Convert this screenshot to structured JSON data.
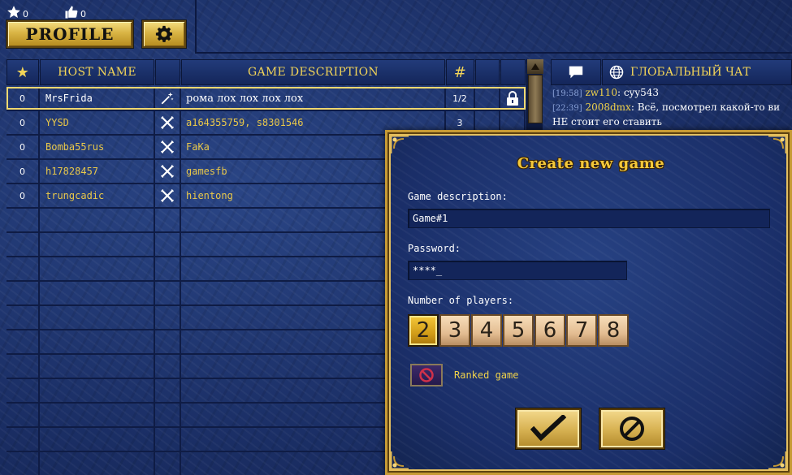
{
  "player": {
    "stars": "0",
    "likes": "0"
  },
  "toolbar": {
    "profile_label": "PROFILE"
  },
  "list": {
    "headers": {
      "rank": "★",
      "host": "HOST NAME",
      "desc": "GAME DESCRIPTION",
      "count": "#"
    },
    "rows": [
      {
        "rank": "0",
        "host": "MrsFrida",
        "desc": "рома лох лох лох лох",
        "count": "1/2",
        "mode": "magic-wand-icon",
        "locked": true
      },
      {
        "rank": "0",
        "host": "YYSD",
        "desc": "a164355759, s8301546",
        "count": "3",
        "mode": "crossed-swords-icon",
        "locked": false
      },
      {
        "rank": "0",
        "host": "Bomba55rus",
        "desc": "FaKa",
        "count": "",
        "mode": "crossed-swords-icon",
        "locked": false
      },
      {
        "rank": "0",
        "host": "h17828457",
        "desc": "gamesfb",
        "count": "",
        "mode": "crossed-swords-icon",
        "locked": false
      },
      {
        "rank": "0",
        "host": "trungcadic",
        "desc": "hientong",
        "count": "",
        "mode": "crossed-swords-icon",
        "locked": false
      }
    ]
  },
  "chat": {
    "title": "ГЛОБАЛЬНЫЙ ЧАТ",
    "messages": [
      {
        "time": "[19:58]",
        "user": "zw110",
        "text": "cyy543"
      },
      {
        "time": "[22:39]",
        "user": "2008dmx",
        "text": "Всё, посмотрел какой-то ви"
      },
      {
        "time": "",
        "user": "",
        "text": "НЕ стоит его ставить"
      }
    ]
  },
  "dialog": {
    "title": "Create new game",
    "desc_label": "Game description:",
    "desc_value": "Game#1",
    "password_label": "Password:",
    "password_value": "****_",
    "players_label": "Number of players:",
    "players_options": [
      "2",
      "3",
      "4",
      "5",
      "6",
      "7",
      "8"
    ],
    "players_selected": "2",
    "ranked_label": "Ranked game",
    "ranked_enabled": false
  },
  "colors": {
    "gold": "#f0d24a",
    "panel_blue": "#1d3268",
    "selected_gold": "#d29d18"
  }
}
